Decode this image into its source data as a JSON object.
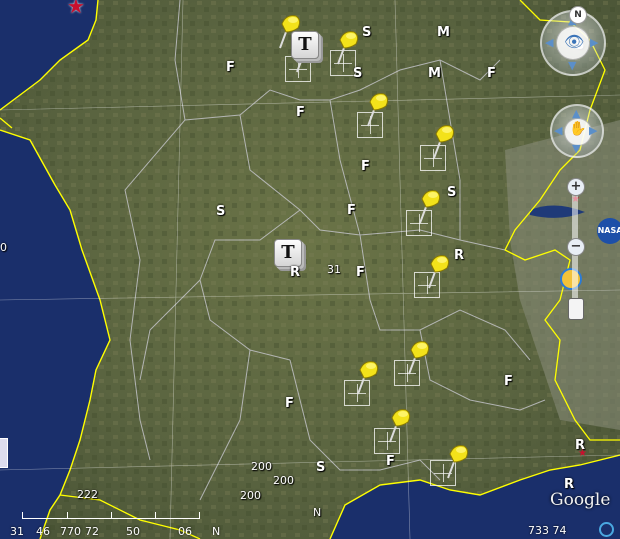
{
  "map": {
    "colors": {
      "ocean": "#1a2f6b",
      "land": "#5c6a3e",
      "coastline": "#ffff00",
      "border": "#c8c8d0"
    },
    "labels": [
      {
        "text": "F"
      },
      {
        "text": "F"
      },
      {
        "text": "F"
      },
      {
        "text": "F"
      },
      {
        "text": "F"
      },
      {
        "text": "F"
      },
      {
        "text": "F"
      },
      {
        "text": "F"
      },
      {
        "text": "F"
      },
      {
        "text": "S"
      },
      {
        "text": "S"
      },
      {
        "text": "S"
      },
      {
        "text": "S"
      },
      {
        "text": "S"
      },
      {
        "text": "M"
      },
      {
        "text": "M"
      },
      {
        "text": "R"
      },
      {
        "text": "R"
      },
      {
        "text": "R"
      },
      {
        "text": "R"
      },
      {
        "text": "N"
      }
    ],
    "small_labels": [
      {
        "text": "31"
      },
      {
        "text": "200"
      },
      {
        "text": "200"
      },
      {
        "text": "200"
      },
      {
        "text": "222"
      },
      {
        "text": "0"
      },
      {
        "text": "N"
      }
    ],
    "pins": [
      {
        "icon": "pushpin-icon"
      },
      {
        "icon": "pushpin-icon"
      },
      {
        "icon": "pushpin-icon"
      },
      {
        "icon": "pushpin-icon"
      },
      {
        "icon": "pushpin-icon"
      },
      {
        "icon": "pushpin-icon"
      },
      {
        "icon": "pushpin-icon"
      },
      {
        "icon": "pushpin-icon"
      },
      {
        "icon": "pushpin-icon"
      },
      {
        "icon": "pushpin-icon"
      },
      {
        "icon": "pushpin-icon"
      }
    ],
    "news_markers": [
      {
        "glyph": "T"
      },
      {
        "glyph": "T"
      }
    ]
  },
  "controls": {
    "compass_label": "N",
    "zoom_in_label": "+",
    "zoom_out_label": "−"
  },
  "status": {
    "scale_numbers": [
      "31",
      "46",
      "770",
      "72",
      "50",
      "06"
    ],
    "coord_text": "733 74",
    "watermark": "Google",
    "badge_nasa": "NASA"
  }
}
